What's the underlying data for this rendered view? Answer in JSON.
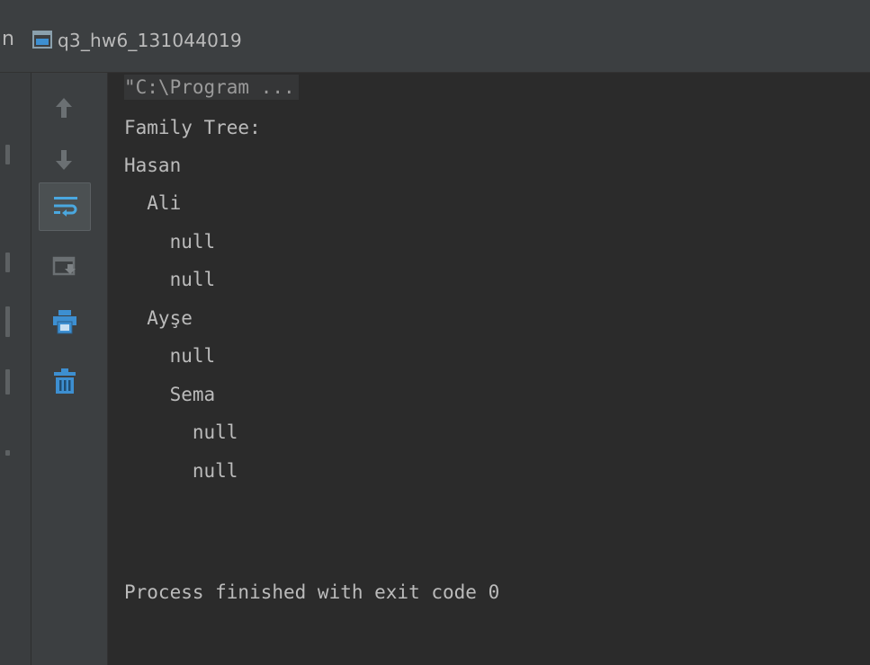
{
  "header": {
    "prefix": "n",
    "title": "q3_hw6_131044019"
  },
  "toolbar": {
    "buttons": [
      {
        "name": "up-arrow-icon",
        "label": "Up"
      },
      {
        "name": "down-arrow-icon",
        "label": "Down"
      },
      {
        "name": "soft-wrap-icon",
        "label": "Soft-wrap"
      },
      {
        "name": "scroll-to-end-icon",
        "label": "Scroll to end"
      },
      {
        "name": "print-icon",
        "label": "Print"
      },
      {
        "name": "trash-icon",
        "label": "Clear all"
      }
    ]
  },
  "console": {
    "command": "\"C:\\Program ...",
    "lines": [
      "Family Tree:",
      "Hasan",
      "  Ali",
      "    null",
      "    null",
      "  Ayşe",
      "    null",
      "    Sema",
      "      null",
      "      null"
    ],
    "exit_message": "Process finished with exit code 0"
  },
  "colors": {
    "background": "#2b2b2b",
    "panel": "#3c3f41",
    "text": "#bbbbbb",
    "accent_blue": "#3d8fd1",
    "active_icon": "#4aa8e0"
  }
}
